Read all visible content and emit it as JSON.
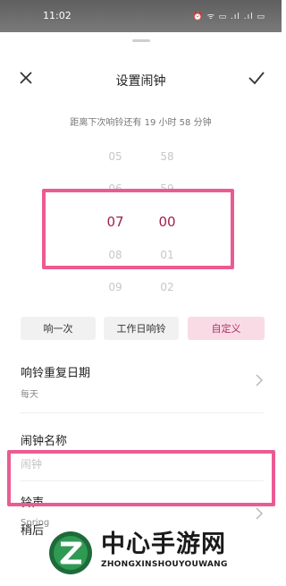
{
  "status_bar": {
    "time": "11:02",
    "icons_text": "⏰ ᯤ ▭ .ıl .ıl ▭"
  },
  "dialog": {
    "title": "设置闹钟",
    "countdown": "距离下次响铃还有 19 小时 58 分钟"
  },
  "picker": {
    "hours": [
      "05",
      "06",
      "07",
      "08",
      "09"
    ],
    "minutes": [
      "58",
      "59",
      "00",
      "01",
      "02"
    ],
    "selected_hour": "07",
    "selected_minute": "00"
  },
  "repeat_options": [
    {
      "label": "响一次",
      "active": false
    },
    {
      "label": "工作日响铃",
      "active": false
    },
    {
      "label": "自定义",
      "active": true
    }
  ],
  "settings": {
    "repeat_days": {
      "label": "响铃重复日期",
      "value": "每天"
    },
    "alarm_name": {
      "label": "闹钟名称",
      "placeholder": "闹钟"
    },
    "ringtone": {
      "label": "铃声",
      "value": "Spring"
    },
    "snooze_label": "稍后"
  },
  "watermark": {
    "brand": "中心手游网",
    "subtitle": "ZHONGXINSHOUYOUWANG"
  },
  "colors": {
    "accent": "#a02050",
    "highlight_border": "#ea5b94",
    "active_chip": "#f9dbe6"
  }
}
